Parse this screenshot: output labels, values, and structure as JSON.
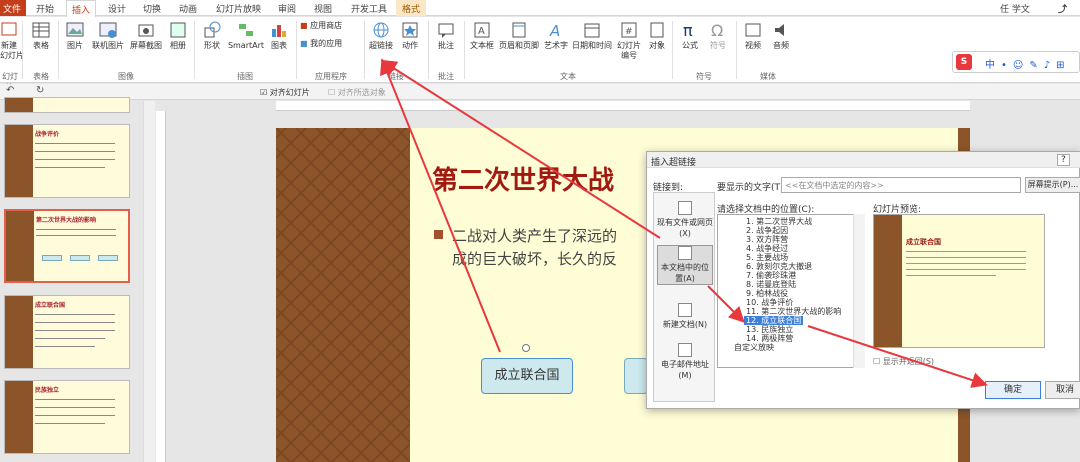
{
  "tabs": [
    {
      "label": "文件"
    },
    {
      "label": "开始"
    },
    {
      "label": "插入"
    },
    {
      "label": "设计"
    },
    {
      "label": "切换"
    },
    {
      "label": "动画"
    },
    {
      "label": "幻灯片放映"
    },
    {
      "label": "审阅"
    },
    {
      "label": "视图"
    },
    {
      "label": "开发工具"
    },
    {
      "label": "格式"
    }
  ],
  "user": "任 学文",
  "ribbon": {
    "new_slide": "新建\n幻灯片",
    "table": "表格",
    "picture": "图片",
    "online_picture": "联机图片",
    "screenshot": "屏幕截图",
    "album": "相册",
    "shapes": "形状",
    "smartart": "SmartArt",
    "chart": "图表",
    "store": "应用商店",
    "my_apps": "我的应用",
    "hyperlink": "超链接",
    "action": "动作",
    "comment": "批注",
    "textbox": "文本框",
    "header_footer": "页眉和页脚",
    "wordart": "艺术字",
    "datetime": "日期和时间",
    "slide_number": "幻灯片\n编号",
    "object": "对象",
    "equation": "公式",
    "symbol": "符号",
    "video": "视频",
    "audio": "音频",
    "groups": {
      "slides": "幻灯片",
      "tables": "表格",
      "images": "图像",
      "illustrations": "插图",
      "apps": "应用程序",
      "links": "链接",
      "comments": "批注",
      "text": "文本",
      "symbols": "符号",
      "media": "媒体"
    }
  },
  "qat": {
    "align_slide": "对齐幻灯片",
    "align_selected": "对齐所选对象"
  },
  "thumbs": [
    {
      "title": "战争评价"
    },
    {
      "title": "第二次世界大战的影响"
    },
    {
      "title": "成立联合国"
    },
    {
      "title": "民族独立"
    }
  ],
  "slide": {
    "title": "第二次世界大战",
    "line1": "二战对人类产生了深远的",
    "line2": "成的巨大破坏，长久的反",
    "shape_label": "成立联合国"
  },
  "dialog": {
    "title": "插入超链接",
    "link_to": "链接到:",
    "display_text_label": "要显示的文字(T):",
    "display_text_value": "<<在文档中选定的内容>>",
    "screen_tip": "屏幕提示(P)...",
    "select_place": "请选择文档中的位置(C):",
    "preview_label": "幻灯片预览:",
    "show_return": "显示并返回(S)",
    "ok": "确定",
    "cancel": "取消",
    "nav": [
      {
        "label": "现有文件或网页(X)"
      },
      {
        "label": "本文档中的位置(A)"
      },
      {
        "label": "新建文档(N)"
      },
      {
        "label": "电子邮件地址(M)"
      }
    ],
    "tree": [
      {
        "label": "1. 第二次世界大战"
      },
      {
        "label": "2. 战争起因"
      },
      {
        "label": "3. 双方阵营"
      },
      {
        "label": "4. 战争经过"
      },
      {
        "label": "5. 主要战场"
      },
      {
        "label": "6. 敦刻尔克大撤退"
      },
      {
        "label": "7. 偷袭珍珠港"
      },
      {
        "label": "8. 诺曼底登陆"
      },
      {
        "label": "9. 柏林战役"
      },
      {
        "label": "10. 战争评价"
      },
      {
        "label": "11. 第二次世界大战的影响"
      },
      {
        "label": "12. 成立联合国"
      },
      {
        "label": "13. 民族独立"
      },
      {
        "label": "14. 两极阵营"
      },
      {
        "label": "自定义放映"
      }
    ],
    "preview_title": "成立联合国"
  },
  "colors": {
    "accent": "#c43e1c",
    "wood": "#8b5529",
    "slide_bg": "#fffdd6",
    "title_red": "#a01a12",
    "arrow": "#e8383d"
  }
}
